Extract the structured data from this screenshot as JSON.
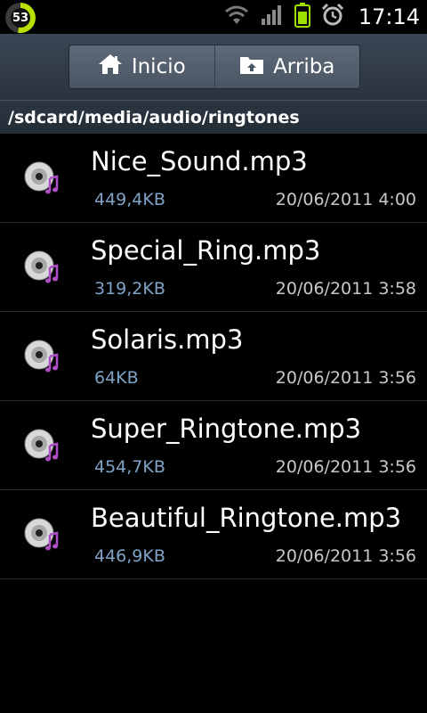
{
  "status_bar": {
    "battery_level": "53",
    "time": "17:14",
    "icons": [
      "wifi-icon",
      "signal-icon",
      "battery-icon",
      "alarm-icon"
    ]
  },
  "toolbar": {
    "home_label": "Inicio",
    "up_label": "Arriba"
  },
  "path": "/sdcard/media/audio/ringtones",
  "files": [
    {
      "name": "Nice_Sound.mp3",
      "size": "449,4KB",
      "date": "20/06/2011 4:00"
    },
    {
      "name": "Special_Ring.mp3",
      "size": "319,2KB",
      "date": "20/06/2011 3:58"
    },
    {
      "name": "Solaris.mp3",
      "size": "64KB",
      "date": "20/06/2011 3:56"
    },
    {
      "name": "Super_Ringtone.mp3",
      "size": "454,7KB",
      "date": "20/06/2011 3:56"
    },
    {
      "name": "Beautiful_Ringtone.mp3",
      "size": "446,9KB",
      "date": "20/06/2011 3:56"
    }
  ],
  "colors": {
    "accent": "#7fa3c7",
    "battery": "#b8e000",
    "toolbar": "#3b4755"
  }
}
